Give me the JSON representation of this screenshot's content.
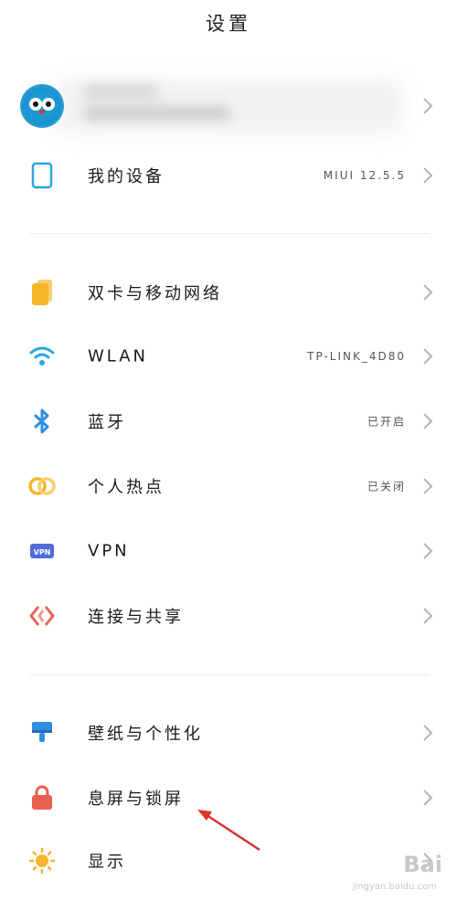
{
  "header": {
    "title": "设置"
  },
  "profile": {
    "name": "",
    "account": ""
  },
  "device": {
    "label": "我的设备",
    "value": "MIUI 12.5.5"
  },
  "network": [
    {
      "label": "双卡与移动网络",
      "value": "",
      "icon": "sim-card-icon",
      "color": "#f5b52a"
    },
    {
      "label": "WLAN",
      "value": "TP-LINK_4D80",
      "icon": "wifi-icon",
      "color": "#2aa7e0"
    },
    {
      "label": "蓝牙",
      "value": "已开启",
      "icon": "bluetooth-icon",
      "color": "#2f8ee0"
    },
    {
      "label": "个人热点",
      "value": "已关闭",
      "icon": "hotspot-icon",
      "color": "#f5b52a"
    },
    {
      "label": "VPN",
      "value": "",
      "icon": "vpn-icon",
      "color": "#4f6bdc"
    },
    {
      "label": "连接与共享",
      "value": "",
      "icon": "connection-sharing-icon",
      "color": "#e8614f"
    }
  ],
  "personal": [
    {
      "label": "壁纸与个性化",
      "icon": "wallpaper-icon",
      "color": "#2f8ee0"
    },
    {
      "label": "息屏与锁屏",
      "icon": "lock-icon",
      "color": "#e8614f"
    },
    {
      "label": "显示",
      "icon": "sun-icon",
      "color": "#f5b52a"
    }
  ],
  "watermark": {
    "text": "Bai",
    "sub": "jingyan.baidu.com"
  }
}
